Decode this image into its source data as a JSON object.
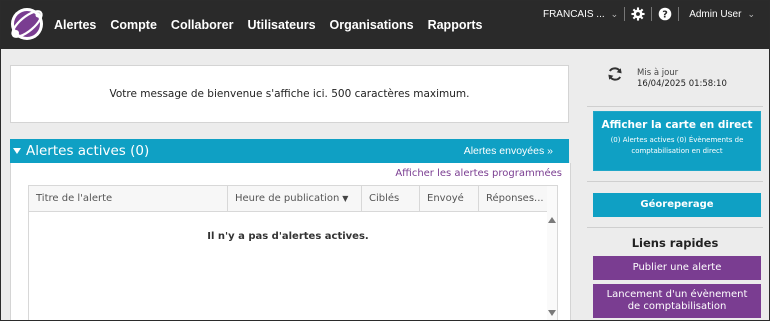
{
  "nav": {
    "items": [
      "Alertes",
      "Compte",
      "Collaborer",
      "Utilisateurs",
      "Organisations",
      "Rapports"
    ]
  },
  "topbar": {
    "language": "FRANCAIS ...",
    "user": "Admin User",
    "icons": [
      "logo-icon",
      "gear-icon",
      "help-icon",
      "chevron-down-icon"
    ]
  },
  "welcome": {
    "message": "Votre message de bienvenue s'affiche ici. 500 caractères maximum."
  },
  "alerts": {
    "title": "Alertes actives (0)",
    "sent_link": "Alertes envoyées »",
    "scheduled_link": "Afficher les alertes programmées",
    "columns": [
      "Titre de l'alerte",
      "Heure de publication",
      "Ciblés",
      "Envoyé",
      "Réponses..."
    ],
    "sorted_column_index": 1,
    "empty_message": "Il n'y a pas d'alertes actives."
  },
  "side": {
    "update_label": "Mis à jour",
    "update_timestamp": "16/04/2025 01:58:10",
    "map_button": {
      "title": "Afficher la carte en direct",
      "subtitle": "(0) Alertes actives (0) Évènements de comptabilisation en direct"
    },
    "geo_button": "Géoreperage",
    "quick_links_title": "Liens rapides",
    "publish_button": "Publier une alerte",
    "launch_button": "Lancement d'un évènement de comptabilisation"
  },
  "colors": {
    "topbar": "#2a2a2a",
    "accent_blue": "#0fa0c4",
    "accent_purple": "#7a3d91",
    "background": "#ececec"
  }
}
